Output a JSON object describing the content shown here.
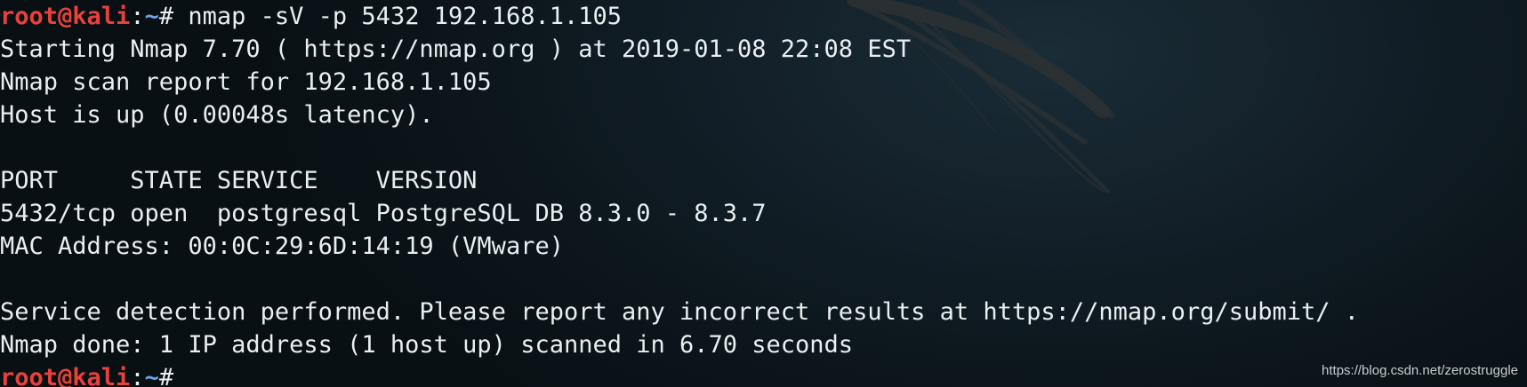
{
  "prompt": {
    "user_host": "root@kali",
    "separator": ":",
    "path": "~",
    "symbol": "#"
  },
  "command": " nmap -sV -p 5432 192.168.1.105",
  "output": {
    "starting": "Starting Nmap 7.70 ( https://nmap.org ) at 2019-01-08 22:08 EST",
    "report_for": "Nmap scan report for 192.168.1.105",
    "host_status": "Host is up (0.00048s latency).",
    "blank_1": "",
    "table_header": "PORT     STATE SERVICE    VERSION",
    "table_row": "5432/tcp open  postgresql PostgreSQL DB 8.3.0 - 8.3.7",
    "mac_address": "MAC Address: 00:0C:29:6D:14:19 (VMware)",
    "blank_2": "",
    "service_detection": "Service detection performed. Please report any incorrect results at https://nmap.org/submit/ .",
    "done": "Nmap done: 1 IP address (1 host up) scanned in 6.70 seconds"
  },
  "watermark": "https://blog.csdn.net/zerostruggle",
  "colors": {
    "background": "#0c161c",
    "text": "#e9eef1",
    "prompt_user": "#e8413b",
    "prompt_path": "#6aa3e8"
  },
  "icons": {
    "background_art": "kali-dragon-icon"
  }
}
